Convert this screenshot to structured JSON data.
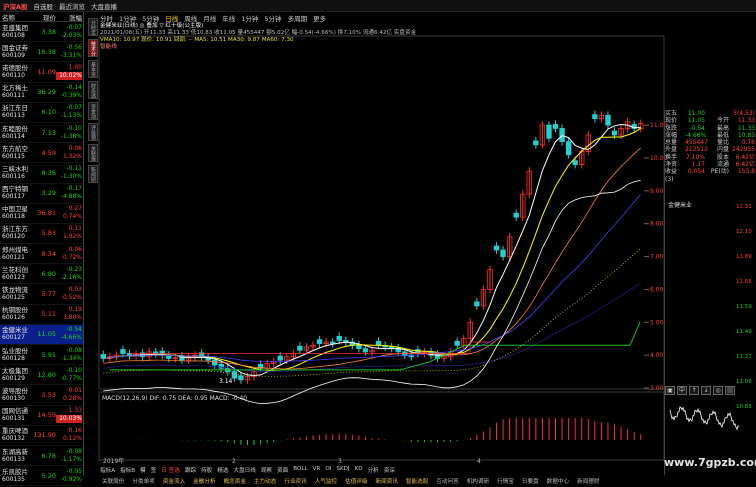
{
  "menubar": {
    "logo": "沪深A股",
    "items": [
      "自选股",
      "最近浏览",
      "大盘直播"
    ]
  },
  "list": {
    "headers": [
      "名称",
      "现价",
      "涨幅"
    ],
    "rows": [
      {
        "name": "亚盛集团",
        "code": "600108",
        "price": "3.38",
        "chg": "-0.07",
        "pct": "-2.03%",
        "dir": "dn",
        "hl": false
      },
      {
        "name": "国金证券",
        "code": "600109",
        "price": "16.38",
        "chg": "-0.56",
        "pct": "-3.31%",
        "dir": "dn",
        "hl": false
      },
      {
        "name": "诺德股份",
        "code": "600110",
        "price": "11.09",
        "chg": "1.00",
        "pct": "10.02%",
        "dir": "up",
        "hl": true
      },
      {
        "name": "北方稀土",
        "code": "600111",
        "price": "36.29",
        "chg": "-0.14",
        "pct": "-0.39%",
        "dir": "dn",
        "hl": false
      },
      {
        "name": "浙江东日",
        "code": "600113",
        "price": "6.10",
        "chg": "-0.07",
        "pct": "-1.13%",
        "dir": "dn",
        "hl": false
      },
      {
        "name": "东睦股份",
        "code": "600114",
        "price": "7.13",
        "chg": "-0.10",
        "pct": "-1.38%",
        "dir": "dn",
        "hl": false
      },
      {
        "name": "东方航空",
        "code": "600115",
        "price": "4.59",
        "chg": "0.06",
        "pct": "1.32%",
        "dir": "up",
        "hl": false
      },
      {
        "name": "三峡水利",
        "code": "600116",
        "price": "8.36",
        "chg": "-0.11",
        "pct": "-1.30%",
        "dir": "dn",
        "hl": false
      },
      {
        "name": "西宁特钢",
        "code": "600117",
        "price": "3.29",
        "chg": "-0.17",
        "pct": "-4.88%",
        "dir": "dn",
        "hl": false
      },
      {
        "name": "中国卫星",
        "code": "600118",
        "price": "36.81",
        "chg": "0.27",
        "pct": "0.74%",
        "dir": "up",
        "hl": false
      },
      {
        "name": "浙江东方",
        "code": "600120",
        "price": "5.83",
        "chg": "0.11",
        "pct": "1.92%",
        "dir": "up",
        "hl": false
      },
      {
        "name": "郑州煤电",
        "code": "600121",
        "price": "8.34",
        "chg": "0.06",
        "pct": "0.72%",
        "dir": "up",
        "hl": false
      },
      {
        "name": "兰花科创",
        "code": "600123",
        "price": "6.80",
        "chg": "-0.23",
        "pct": "-2.16%",
        "dir": "dn",
        "hl": false
      },
      {
        "name": "铁龙物流",
        "code": "600125",
        "price": "5.77",
        "chg": "0.03",
        "pct": "0.52%",
        "dir": "up",
        "hl": false
      },
      {
        "name": "杭钢股份",
        "code": "600126",
        "price": "5.11",
        "chg": "0.19",
        "pct": "3.80%",
        "dir": "up",
        "hl": false
      },
      {
        "name": "金健米业",
        "code": "600127",
        "price": "11.05",
        "chg": "-0.54",
        "pct": "-4.66%",
        "dir": "dn",
        "hl": false,
        "sel": true
      },
      {
        "name": "弘业股份",
        "code": "600128",
        "price": "5.91",
        "chg": "-0.08",
        "pct": "-1.34%",
        "dir": "dn",
        "hl": false
      },
      {
        "name": "太极集团",
        "code": "600129",
        "price": "12.80",
        "chg": "-0.10",
        "pct": "-0.77%",
        "dir": "dn",
        "hl": false
      },
      {
        "name": "波导股份",
        "code": "600130",
        "price": "3.53",
        "chg": "0.01",
        "pct": "0.28%",
        "dir": "up",
        "hl": false
      },
      {
        "name": "国网信通",
        "code": "600131",
        "price": "14.59",
        "chg": "1.33",
        "pct": "10.03%",
        "dir": "up",
        "hl": true
      },
      {
        "name": "重庆啤酒",
        "code": "600132",
        "price": "131.90",
        "chg": "0.16",
        "pct": "0.12%",
        "dir": "up",
        "hl": false
      },
      {
        "name": "东湖高新",
        "code": "600133",
        "price": "6.78",
        "chg": "-0.08",
        "pct": "-1.17%",
        "dir": "dn",
        "hl": false
      },
      {
        "name": "乐凯胶片",
        "code": "600135",
        "price": "5.20",
        "chg": "-0.05",
        "pct": "-0.92%",
        "dir": "dn",
        "hl": false
      }
    ]
  },
  "sidetabs": [
    "分时走势",
    "技术分析",
    "基本资料",
    "财务透视",
    "资金动向",
    "评级预测",
    "关联报价",
    "新闻研报"
  ],
  "toolbar": {
    "items": [
      "分时",
      "1分钟",
      "5分钟",
      "日线",
      "周线",
      "月线",
      "年线",
      "1分钟",
      "5分钟",
      "多周期",
      "更多"
    ]
  },
  "info": {
    "line1": "金健米业(日线)  ◎ 叠加  ▽ 红十级(公主版)",
    "line2": "2021/01/08(五) 开11.33 高11.33 低10.83 收11.05 量455447 额5.02亿 幅-0.54(-4.66%) 换7.10% 流通6.42亿 实盘资金",
    "line3": "VMA10: 10.97  现价: 10.91  回调: --  MA5: 10.51  MA30: 9.87  MA60: 7.30",
    "line4": "智能线"
  },
  "quote": {
    "rows": [
      [
        "买五",
        "11.00",
        "",
        "5(4,53)"
      ],
      [
        "现价",
        "11.05",
        "今开",
        "11.33"
      ],
      [
        "涨跌",
        "-0.54",
        "最高",
        "11.33"
      ],
      [
        "涨幅",
        "-4.66%",
        "最低",
        "10.83"
      ],
      [
        "总量",
        "455447",
        "量比",
        "0.76"
      ],
      [
        "外盘",
        "212512",
        "内盘",
        "242935"
      ],
      [
        "换手",
        "7.10%",
        "股本",
        "6.42亿"
      ],
      [
        "净资",
        "1.17",
        "流通",
        "6.42亿"
      ],
      [
        "收益(3)",
        "0.054",
        "PE(动)",
        "153.8"
      ]
    ],
    "title": "金健米业",
    "mini_ticks": [
      "12.31",
      "12.10",
      "11.89",
      "11.68",
      "11.59",
      "11.49",
      "11.27",
      "11.06",
      "10.85"
    ],
    "tick_buttons": [
      "▣",
      "中",
      "↑",
      "↓",
      "◎",
      "|||"
    ]
  },
  "bottombar": {
    "items": [
      "指标A",
      "指标B",
      "模",
      "签",
      "日 签选",
      "跟踪",
      "持股",
      "精选",
      "大盘日线",
      "观察",
      "资面",
      "BOLL",
      "VR",
      "OI",
      "SKDJ",
      "KD",
      "分析",
      "资深"
    ]
  },
  "tabbar": {
    "items": [
      "关联股份",
      "分类单项",
      "资金流入",
      "金融分析",
      "概念资金",
      "主力动态",
      "行业资讯",
      "人气监控",
      "估值评级",
      "新闻资讯",
      "智能选股",
      "互动问答",
      "机构调研",
      "行情宝",
      "日要盘",
      "数据中心",
      "新闻理财"
    ]
  },
  "watermark": "www.7gpzb.com",
  "colors": {
    "up": "#ff4040",
    "down": "#20d020",
    "ma5": "#ffffff",
    "ma10": "#ffff00",
    "ma30": "#4040ff",
    "dark_line": "#202080",
    "channel": "#20c020"
  },
  "chart_data": {
    "type": "candlestick",
    "price_axis": {
      "labels": [
        "11.00",
        "10.00",
        "9.00",
        "8.00",
        "7.00",
        "6.00",
        "5.00",
        "4.00",
        "3.00"
      ],
      "range": [
        3.0,
        11.0
      ]
    },
    "x_labels": [
      "2019年",
      "2",
      "3",
      "4"
    ],
    "annotation_low": "3.14",
    "macd": {
      "label": "MACD(12,26,9)  DIF: 0.75  DEA: 0.95  MACD: -0.40",
      "dif": 0.75,
      "dea": 0.95,
      "macd": -0.4
    },
    "closes": [
      3.9,
      3.95,
      4.0,
      4.05,
      3.98,
      4.02,
      3.95,
      4.1,
      4.05,
      4.0,
      3.9,
      3.92,
      3.85,
      3.95,
      4.0,
      3.95,
      3.85,
      3.7,
      3.6,
      3.5,
      3.3,
      3.25,
      3.35,
      3.5,
      3.6,
      3.75,
      3.8,
      3.85,
      3.95,
      4.05,
      4.15,
      4.25,
      4.3,
      4.35,
      4.4,
      4.35,
      4.45,
      4.4,
      4.3,
      4.2,
      4.1,
      4.15,
      4.3,
      4.25,
      4.2,
      4.1,
      4.0,
      3.95,
      4.05,
      4.1,
      4.0,
      3.9,
      3.95,
      4.1,
      4.3,
      4.5,
      5.0,
      5.5,
      6.0,
      6.6,
      7.2,
      7.0,
      7.6,
      8.2,
      8.9,
      9.6,
      10.4,
      11.0,
      10.6,
      10.9,
      10.5,
      10.1,
      9.8,
      10.2,
      10.7,
      11.2,
      11.3,
      11.0,
      10.7,
      10.9,
      11.1,
      10.9,
      11.05
    ],
    "ma5_note": "white",
    "ma10_note": "yellow",
    "ma30_note": "blue"
  }
}
